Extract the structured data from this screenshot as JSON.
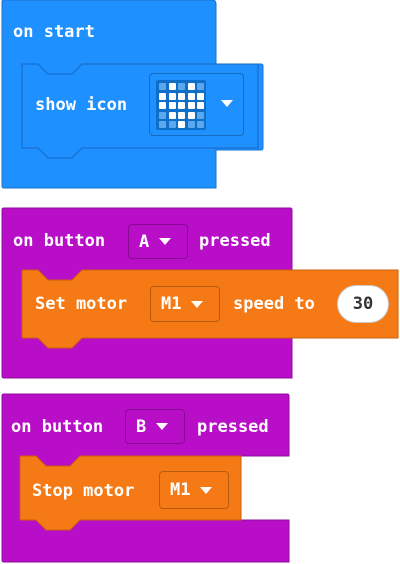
{
  "colors": {
    "basic": "#1e90ff",
    "input": "#b80ec8",
    "motor": "#f57a15",
    "led_on": "#ffffff",
    "led_off": "#5aa9ee"
  },
  "on_start_block": {
    "label": "on start",
    "show_icon": {
      "label": "show icon",
      "icon_name": "heart-icon",
      "led_pattern": [
        [
          0,
          1,
          0,
          1,
          0
        ],
        [
          1,
          1,
          1,
          1,
          1
        ],
        [
          1,
          1,
          1,
          1,
          1
        ],
        [
          0,
          1,
          1,
          1,
          0
        ],
        [
          0,
          0,
          1,
          0,
          0
        ]
      ]
    }
  },
  "button_a_block": {
    "prefix": "on button",
    "button_value": "A",
    "suffix": "pressed",
    "set_motor": {
      "label": "Set motor",
      "motor_value": "M1",
      "speed_label": "speed to",
      "speed_value": "30"
    }
  },
  "button_b_block": {
    "prefix": "on button",
    "button_value": "B",
    "suffix": "pressed",
    "stop_motor": {
      "label": "Stop motor",
      "motor_value": "M1"
    }
  }
}
